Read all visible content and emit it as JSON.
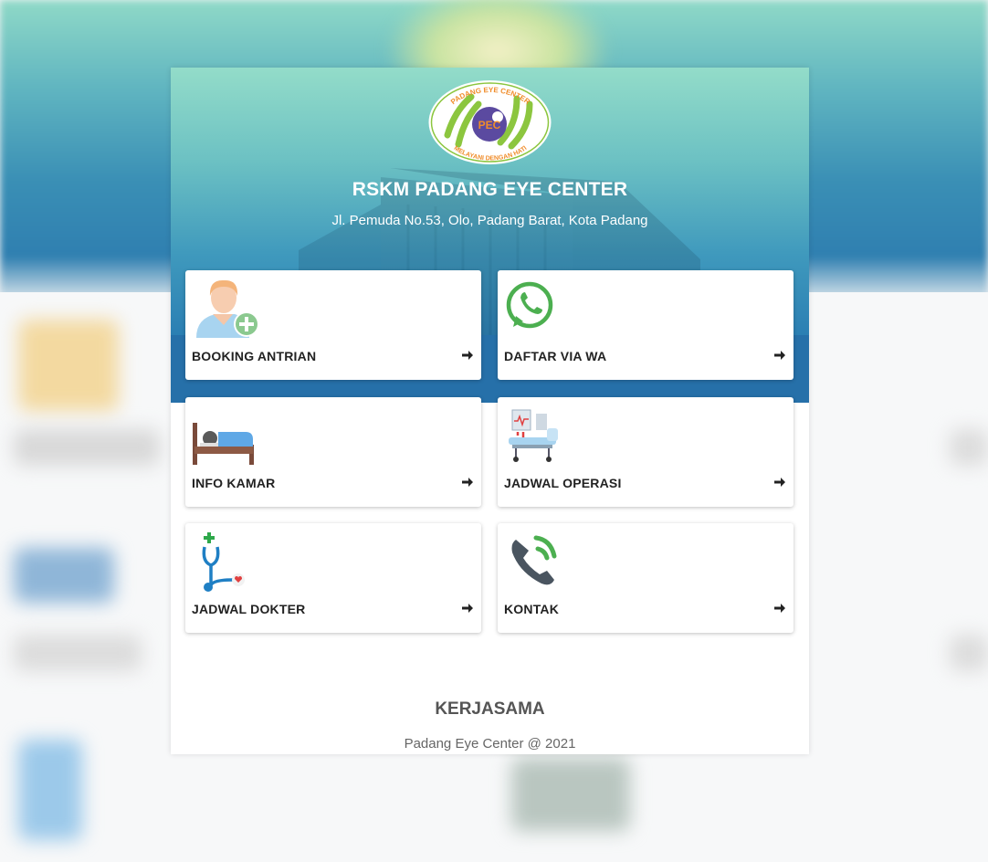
{
  "hospital": {
    "name": "RSKM PADANG EYE CENTER",
    "address": "Jl. Pemuda No.53, Olo, Padang Barat, Kota Padang",
    "logo_top_text": "PADANG EYE CENTER",
    "logo_center_text": "PEC",
    "logo_bottom_text": "MELAYANI DENGAN HATI"
  },
  "menu": [
    {
      "label": "BOOKING ANTRIAN",
      "icon": "user-add-icon"
    },
    {
      "label": "DAFTAR VIA WA",
      "icon": "whatsapp-icon"
    },
    {
      "label": "INFO KAMAR",
      "icon": "bed-icon"
    },
    {
      "label": "JADWAL OPERASI",
      "icon": "operating-table-icon"
    },
    {
      "label": "JADWAL DOKTER",
      "icon": "stethoscope-icon"
    },
    {
      "label": "KONTAK",
      "icon": "phone-call-icon"
    }
  ],
  "section_title": "KERJASAMA",
  "footer": "Padang Eye Center @ 2021",
  "colors": {
    "accent_green": "#8cc63f",
    "logo_purple": "#5b4aa0",
    "whatsapp": "#4caf50",
    "header_blue": "#2670a9"
  }
}
